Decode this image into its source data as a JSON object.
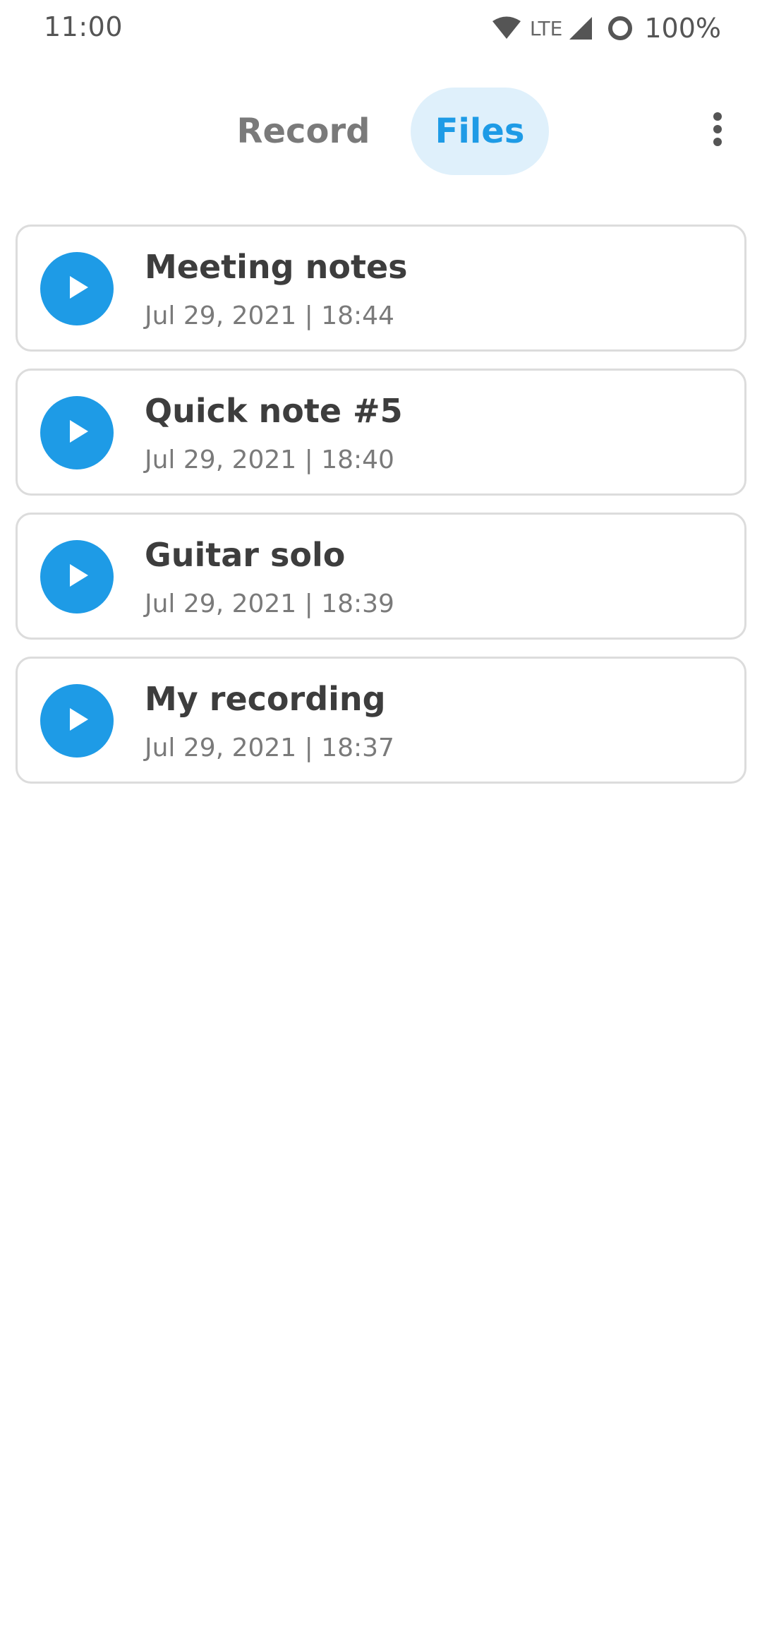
{
  "status_bar": {
    "time": "11:00",
    "network": "LTE",
    "battery": "100%",
    "icons": [
      "wifi-icon",
      "cell-signal-icon",
      "battery-icon"
    ]
  },
  "header": {
    "tabs": [
      {
        "label": "Record",
        "selected": false
      },
      {
        "label": "Files",
        "selected": true
      }
    ],
    "menu_icon": "overflow-menu-icon"
  },
  "colors": {
    "accent": "#1e9be6",
    "tab_selected_bg": "#dff0fb",
    "title_text": "#3d3d3d",
    "secondary_text": "#7a7a7a",
    "card_border": "#dcdcdc"
  },
  "recordings": [
    {
      "title": "Meeting notes",
      "date": "Jul 29, 2021",
      "time": "18:44",
      "meta": "Jul 29, 2021 | 18:44"
    },
    {
      "title": "Quick note #5",
      "date": "Jul 29, 2021",
      "time": "18:40",
      "meta": "Jul 29, 2021 | 18:40"
    },
    {
      "title": "Guitar solo",
      "date": "Jul 29, 2021",
      "time": "18:39",
      "meta": "Jul 29, 2021 | 18:39"
    },
    {
      "title": "My recording",
      "date": "Jul 29, 2021",
      "time": "18:37",
      "meta": "Jul 29, 2021 | 18:37"
    }
  ]
}
